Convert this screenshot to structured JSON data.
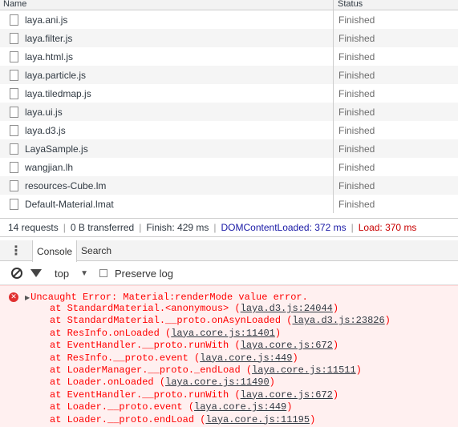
{
  "network": {
    "columns": {
      "name": "Name",
      "status": "Status"
    },
    "rows": [
      {
        "name": "laya.ani.js",
        "status": "Finished"
      },
      {
        "name": "laya.filter.js",
        "status": "Finished"
      },
      {
        "name": "laya.html.js",
        "status": "Finished"
      },
      {
        "name": "laya.particle.js",
        "status": "Finished"
      },
      {
        "name": "laya.tiledmap.js",
        "status": "Finished"
      },
      {
        "name": "laya.ui.js",
        "status": "Finished"
      },
      {
        "name": "laya.d3.js",
        "status": "Finished"
      },
      {
        "name": "LayaSample.js",
        "status": "Finished"
      },
      {
        "name": "wangjian.lh",
        "status": "Finished"
      },
      {
        "name": "resources-Cube.lm",
        "status": "Finished"
      },
      {
        "name": "Default-Material.lmat",
        "status": "Finished"
      }
    ]
  },
  "summary": {
    "requests": "14 requests",
    "transferred": "0 B transferred",
    "finish": "Finish: 429 ms",
    "dcl": "DOMContentLoaded: 372 ms",
    "load": "Load: 370 ms",
    "separator": "|"
  },
  "drawer": {
    "menu_glyph": "⋮",
    "tabs": [
      {
        "label": "Console",
        "active": true
      },
      {
        "label": "Search",
        "active": false
      }
    ]
  },
  "console_toolbar": {
    "context": "top",
    "context_arrow": "▼",
    "preserve_log": "Preserve log"
  },
  "error": {
    "icon_glyph": "✕",
    "expand_glyph": "▶",
    "message": "Uncaught Error: Material:renderMode value error.",
    "stack": [
      {
        "prefix": "at StandardMaterial.<anonymous> (",
        "link": "laya.d3.js:24044",
        "suffix": ")"
      },
      {
        "prefix": "at StandardMaterial.__proto.onAsynLoaded (",
        "link": "laya.d3.js:23826",
        "suffix": ")"
      },
      {
        "prefix": "at ResInfo.onLoaded (",
        "link": "laya.core.js:11401",
        "suffix": ")"
      },
      {
        "prefix": "at EventHandler.__proto.runWith (",
        "link": "laya.core.js:672",
        "suffix": ")"
      },
      {
        "prefix": "at ResInfo.__proto.event (",
        "link": "laya.core.js:449",
        "suffix": ")"
      },
      {
        "prefix": "at LoaderManager.__proto._endLoad (",
        "link": "laya.core.js:11511",
        "suffix": ")"
      },
      {
        "prefix": "at Loader.onLoaded (",
        "link": "laya.core.js:11490",
        "suffix": ")"
      },
      {
        "prefix": "at EventHandler.__proto.runWith (",
        "link": "laya.core.js:672",
        "suffix": ")"
      },
      {
        "prefix": "at Loader.__proto.event (",
        "link": "laya.core.js:449",
        "suffix": ")"
      },
      {
        "prefix": "at Loader.__proto.endLoad (",
        "link": "laya.core.js:11195",
        "suffix": ")"
      }
    ]
  },
  "colors": {
    "error_text": "#ff0000",
    "error_bg": "#fff0f0",
    "dcl_blue": "#1a1aa6",
    "load_red": "#c80000"
  }
}
